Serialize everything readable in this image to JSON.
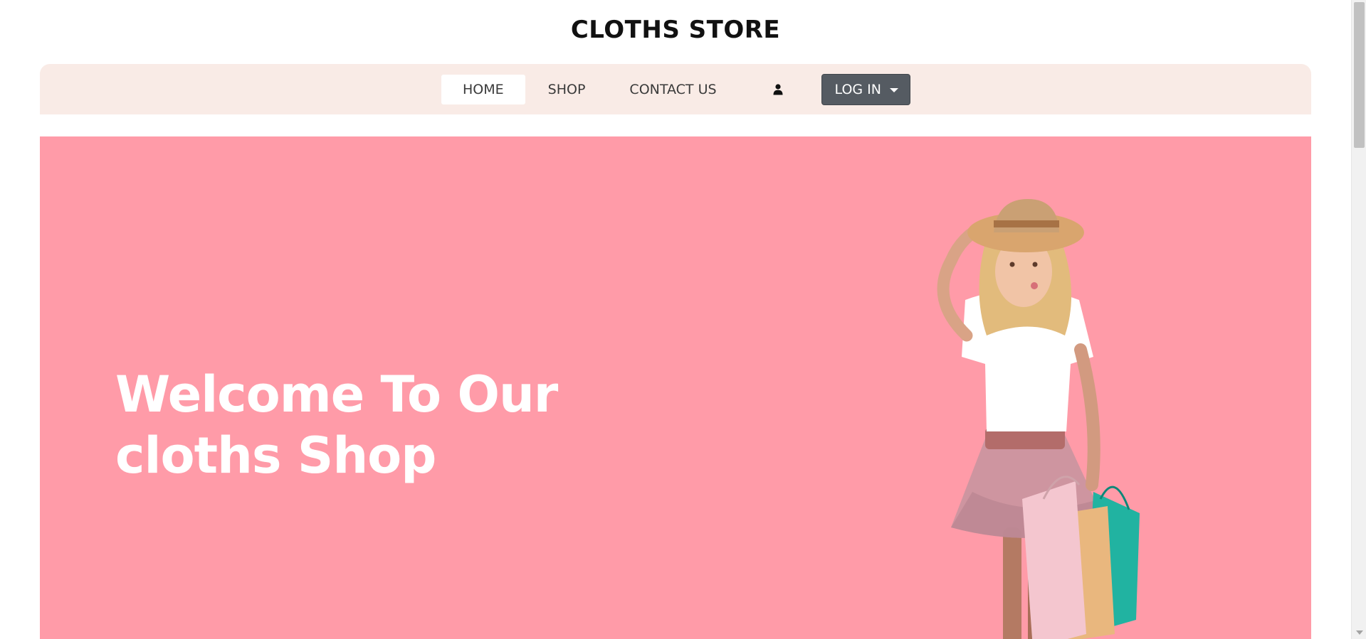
{
  "header": {
    "brand": "CLOTHS STORE"
  },
  "nav": {
    "items": [
      {
        "label": "HOME",
        "active": true
      },
      {
        "label": "SHOP",
        "active": false
      },
      {
        "label": "CONTACT US",
        "active": false
      }
    ],
    "user_icon": "user-icon",
    "login_label": "LOG IN",
    "login_icon": "chevron-down-icon"
  },
  "hero": {
    "title_line1": "Welcome To Our",
    "title_line2": "cloths Shop",
    "background": "#ff9ba8",
    "image": "girl-with-shopping-bags"
  },
  "colors": {
    "nav_background": "#f9ebe6",
    "login_button": "#555b62",
    "hero_background": "#ff9ba8"
  }
}
